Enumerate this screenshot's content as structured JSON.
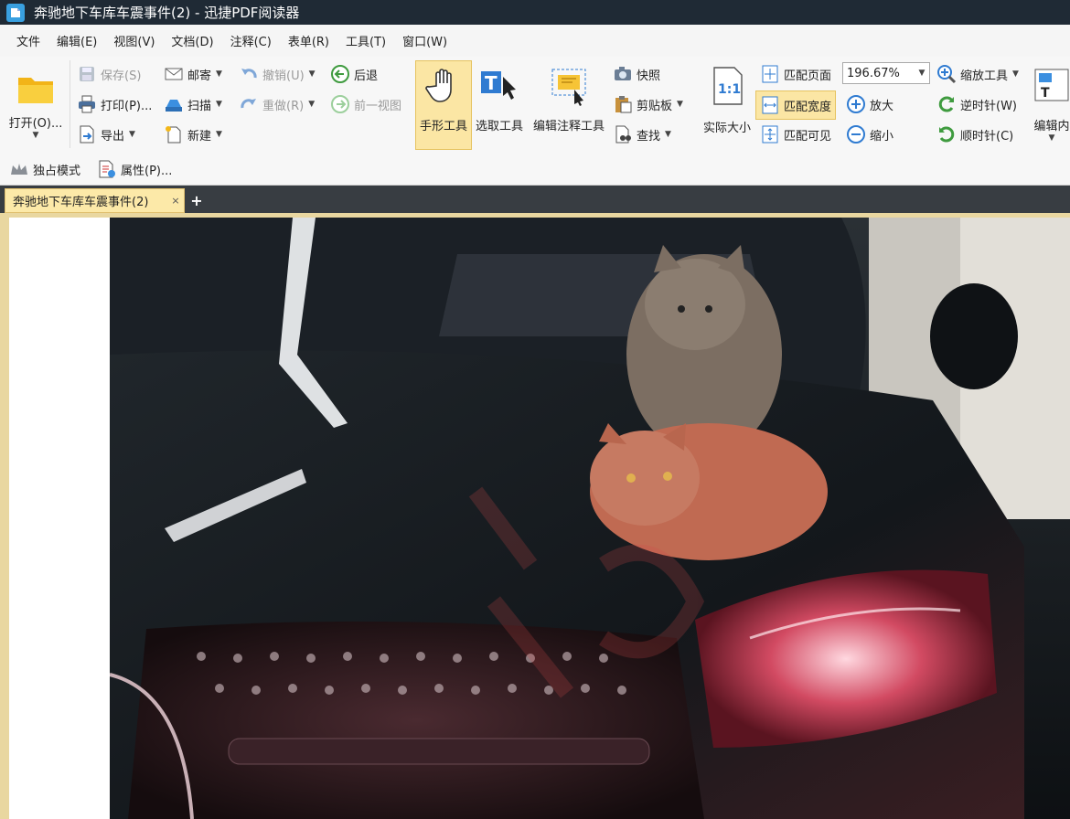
{
  "window": {
    "title": "奔驰地下车库车震事件(2) - 迅捷PDF阅读器"
  },
  "menu": [
    "文件",
    "编辑(E)",
    "视图(V)",
    "文档(D)",
    "注释(C)",
    "表单(R)",
    "工具(T)",
    "窗口(W)"
  ],
  "toolbar": {
    "open": "打开(O)...",
    "save": "保存(S)",
    "print": "打印(P)...",
    "export": "导出",
    "mail": "邮寄",
    "scan": "扫描",
    "new": "新建",
    "undo": "撤销(U)",
    "redo": "重做(R)",
    "back": "后退",
    "prev_view": "前一视图",
    "hand_tool": "手形工具",
    "select_tool": "选取工具",
    "edit_annot_tool": "编辑注释工具",
    "snapshot": "快照",
    "clipboard": "剪贴板",
    "find": "查找",
    "actual_size": "实际大小",
    "actual_size_icon_text": "1:1",
    "fit_page": "匹配页面",
    "fit_width": "匹配宽度",
    "fit_visible": "匹配可见",
    "zoom_value": "196.67%",
    "zoom_in": "放大",
    "zoom_out": "缩小",
    "zoom_tool": "缩放工具",
    "rotate_ccw": "逆时针(W)",
    "rotate_cw": "顺时针(C)",
    "edit_content": "编辑内"
  },
  "secondbar": {
    "exclusive_mode": "独占模式",
    "properties": "属性(P)..."
  },
  "tabs": {
    "doc_tab": "奔驰地下车库车震事件(2)",
    "close": "×",
    "new": "+"
  },
  "colors": {
    "titlebar": "#1f2a35",
    "active_tool": "#fbe6a4",
    "tab_active": "#fce9a8",
    "doc_bg": "#e9d7a0"
  }
}
